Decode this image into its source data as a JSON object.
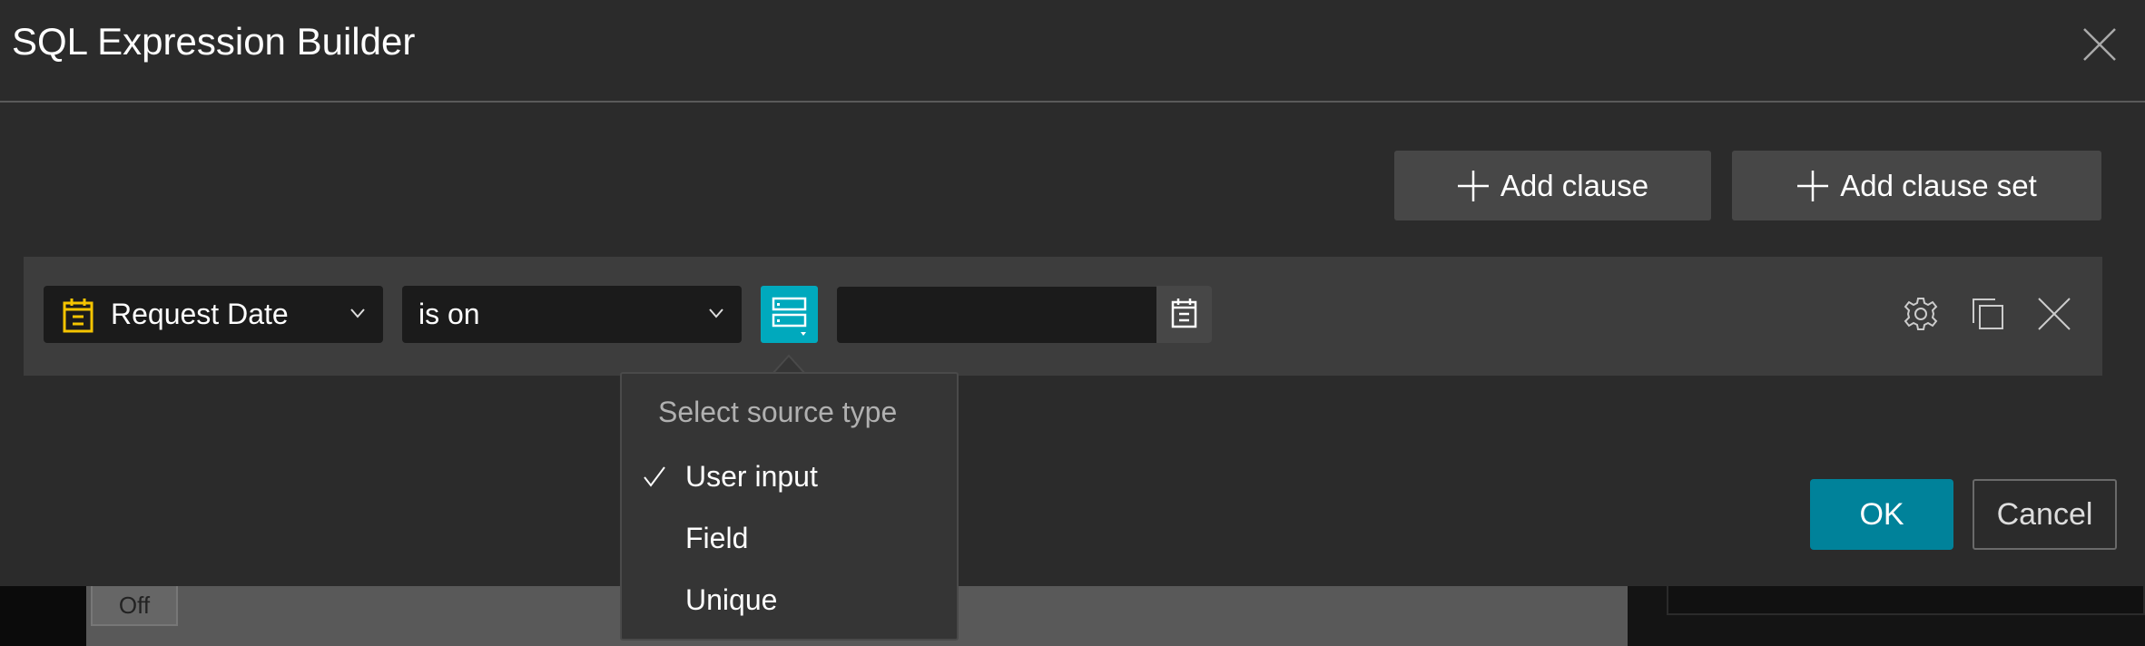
{
  "dialog": {
    "title": "SQL Expression Builder"
  },
  "toolbar": {
    "add_clause": "Add clause",
    "add_clause_set": "Add clause set"
  },
  "clause": {
    "field": "Request Date",
    "operator": "is on",
    "value": "",
    "field_icon_color": "#f5c400"
  },
  "source_popover": {
    "header": "Select source type",
    "items": [
      {
        "label": "User input",
        "selected": true
      },
      {
        "label": "Field",
        "selected": false
      },
      {
        "label": "Unique",
        "selected": false
      }
    ]
  },
  "footer": {
    "ok": "OK",
    "cancel": "Cancel"
  },
  "background": {
    "off_button": "Off"
  },
  "colors": {
    "accent": "#00a9bd",
    "ok": "#00829a"
  }
}
